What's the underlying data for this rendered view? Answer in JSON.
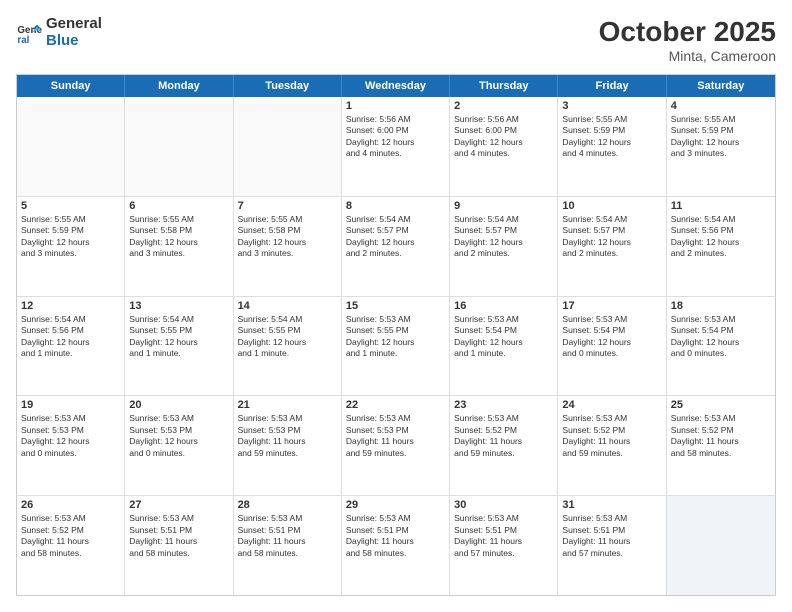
{
  "logo": {
    "line1": "General",
    "line2": "Blue"
  },
  "title": "October 2025",
  "location": "Minta, Cameroon",
  "days_of_week": [
    "Sunday",
    "Monday",
    "Tuesday",
    "Wednesday",
    "Thursday",
    "Friday",
    "Saturday"
  ],
  "weeks": [
    [
      {
        "day": "",
        "info": ""
      },
      {
        "day": "",
        "info": ""
      },
      {
        "day": "",
        "info": ""
      },
      {
        "day": "1",
        "info": "Sunrise: 5:56 AM\nSunset: 6:00 PM\nDaylight: 12 hours\nand 4 minutes."
      },
      {
        "day": "2",
        "info": "Sunrise: 5:56 AM\nSunset: 6:00 PM\nDaylight: 12 hours\nand 4 minutes."
      },
      {
        "day": "3",
        "info": "Sunrise: 5:55 AM\nSunset: 5:59 PM\nDaylight: 12 hours\nand 4 minutes."
      },
      {
        "day": "4",
        "info": "Sunrise: 5:55 AM\nSunset: 5:59 PM\nDaylight: 12 hours\nand 3 minutes."
      }
    ],
    [
      {
        "day": "5",
        "info": "Sunrise: 5:55 AM\nSunset: 5:59 PM\nDaylight: 12 hours\nand 3 minutes."
      },
      {
        "day": "6",
        "info": "Sunrise: 5:55 AM\nSunset: 5:58 PM\nDaylight: 12 hours\nand 3 minutes."
      },
      {
        "day": "7",
        "info": "Sunrise: 5:55 AM\nSunset: 5:58 PM\nDaylight: 12 hours\nand 3 minutes."
      },
      {
        "day": "8",
        "info": "Sunrise: 5:54 AM\nSunset: 5:57 PM\nDaylight: 12 hours\nand 2 minutes."
      },
      {
        "day": "9",
        "info": "Sunrise: 5:54 AM\nSunset: 5:57 PM\nDaylight: 12 hours\nand 2 minutes."
      },
      {
        "day": "10",
        "info": "Sunrise: 5:54 AM\nSunset: 5:57 PM\nDaylight: 12 hours\nand 2 minutes."
      },
      {
        "day": "11",
        "info": "Sunrise: 5:54 AM\nSunset: 5:56 PM\nDaylight: 12 hours\nand 2 minutes."
      }
    ],
    [
      {
        "day": "12",
        "info": "Sunrise: 5:54 AM\nSunset: 5:56 PM\nDaylight: 12 hours\nand 1 minute."
      },
      {
        "day": "13",
        "info": "Sunrise: 5:54 AM\nSunset: 5:55 PM\nDaylight: 12 hours\nand 1 minute."
      },
      {
        "day": "14",
        "info": "Sunrise: 5:54 AM\nSunset: 5:55 PM\nDaylight: 12 hours\nand 1 minute."
      },
      {
        "day": "15",
        "info": "Sunrise: 5:53 AM\nSunset: 5:55 PM\nDaylight: 12 hours\nand 1 minute."
      },
      {
        "day": "16",
        "info": "Sunrise: 5:53 AM\nSunset: 5:54 PM\nDaylight: 12 hours\nand 1 minute."
      },
      {
        "day": "17",
        "info": "Sunrise: 5:53 AM\nSunset: 5:54 PM\nDaylight: 12 hours\nand 0 minutes."
      },
      {
        "day": "18",
        "info": "Sunrise: 5:53 AM\nSunset: 5:54 PM\nDaylight: 12 hours\nand 0 minutes."
      }
    ],
    [
      {
        "day": "19",
        "info": "Sunrise: 5:53 AM\nSunset: 5:53 PM\nDaylight: 12 hours\nand 0 minutes."
      },
      {
        "day": "20",
        "info": "Sunrise: 5:53 AM\nSunset: 5:53 PM\nDaylight: 12 hours\nand 0 minutes."
      },
      {
        "day": "21",
        "info": "Sunrise: 5:53 AM\nSunset: 5:53 PM\nDaylight: 11 hours\nand 59 minutes."
      },
      {
        "day": "22",
        "info": "Sunrise: 5:53 AM\nSunset: 5:53 PM\nDaylight: 11 hours\nand 59 minutes."
      },
      {
        "day": "23",
        "info": "Sunrise: 5:53 AM\nSunset: 5:52 PM\nDaylight: 11 hours\nand 59 minutes."
      },
      {
        "day": "24",
        "info": "Sunrise: 5:53 AM\nSunset: 5:52 PM\nDaylight: 11 hours\nand 59 minutes."
      },
      {
        "day": "25",
        "info": "Sunrise: 5:53 AM\nSunset: 5:52 PM\nDaylight: 11 hours\nand 58 minutes."
      }
    ],
    [
      {
        "day": "26",
        "info": "Sunrise: 5:53 AM\nSunset: 5:52 PM\nDaylight: 11 hours\nand 58 minutes."
      },
      {
        "day": "27",
        "info": "Sunrise: 5:53 AM\nSunset: 5:51 PM\nDaylight: 11 hours\nand 58 minutes."
      },
      {
        "day": "28",
        "info": "Sunrise: 5:53 AM\nSunset: 5:51 PM\nDaylight: 11 hours\nand 58 minutes."
      },
      {
        "day": "29",
        "info": "Sunrise: 5:53 AM\nSunset: 5:51 PM\nDaylight: 11 hours\nand 58 minutes."
      },
      {
        "day": "30",
        "info": "Sunrise: 5:53 AM\nSunset: 5:51 PM\nDaylight: 11 hours\nand 57 minutes."
      },
      {
        "day": "31",
        "info": "Sunrise: 5:53 AM\nSunset: 5:51 PM\nDaylight: 11 hours\nand 57 minutes."
      },
      {
        "day": "",
        "info": ""
      }
    ]
  ]
}
